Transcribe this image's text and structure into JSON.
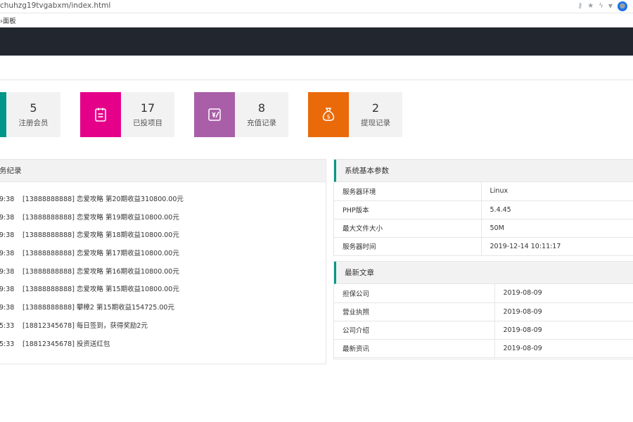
{
  "browser": {
    "url": "chuhzg19tvgabxm/index.html",
    "tab_label": "›面板",
    "icons": [
      "key-icon",
      "star-icon",
      "lightning-icon",
      "chevron-down-icon",
      "profile-icon"
    ]
  },
  "colors": {
    "topbar": "#22262e",
    "green": "#009688",
    "pink": "#e5008a",
    "purple": "#a95fa8",
    "orange": "#ea6a0a"
  },
  "stats": [
    {
      "value": "5",
      "label": "注册会员",
      "icon": "user-icon"
    },
    {
      "value": "17",
      "label": "已投项目",
      "icon": "clipboard-icon"
    },
    {
      "value": "8",
      "label": "充值记录",
      "icon": "recharge-icon"
    },
    {
      "value": "2",
      "label": "提现记录",
      "icon": "money-bag-icon"
    }
  ],
  "log_panel": {
    "title": "务纪录",
    "items": [
      {
        "time": "9:38",
        "text": "[13888888888] 恋爱攻略 第20期收益310800.00元"
      },
      {
        "time": "9:38",
        "text": "[13888888888] 恋爱攻略 第19期收益10800.00元"
      },
      {
        "time": "9:38",
        "text": "[13888888888] 恋爱攻略 第18期收益10800.00元"
      },
      {
        "time": "9:38",
        "text": "[13888888888] 恋爱攻略 第17期收益10800.00元"
      },
      {
        "time": "9:38",
        "text": "[13888888888] 恋爱攻略 第16期收益10800.00元"
      },
      {
        "time": "9:38",
        "text": "[13888888888] 恋爱攻略 第15期收益10800.00元"
      },
      {
        "time": "9:38",
        "text": "[13888888888] 攀樟2 第15期收益154725.00元"
      },
      {
        "time": "5:33",
        "text": "[18812345678] 每日签到，获得奖励2元"
      },
      {
        "time": "5:33",
        "text": "[18812345678] 投资送红包"
      }
    ]
  },
  "system_panel": {
    "title": "系统基本参数",
    "rows": [
      {
        "key": "服务器环境",
        "value": "Linux"
      },
      {
        "key": "PHP版本",
        "value": "5.4.45"
      },
      {
        "key": "最大文件大小",
        "value": "50M"
      },
      {
        "key": "服务器时间",
        "value": "2019-12-14 10:11:17"
      }
    ]
  },
  "articles_panel": {
    "title": "最新文章",
    "rows": [
      {
        "title": "担保公司",
        "date": "2019-08-09"
      },
      {
        "title": "营业执照",
        "date": "2019-08-09"
      },
      {
        "title": "公司介绍",
        "date": "2019-08-09"
      },
      {
        "title": "最新资讯",
        "date": "2019-08-09"
      }
    ]
  }
}
